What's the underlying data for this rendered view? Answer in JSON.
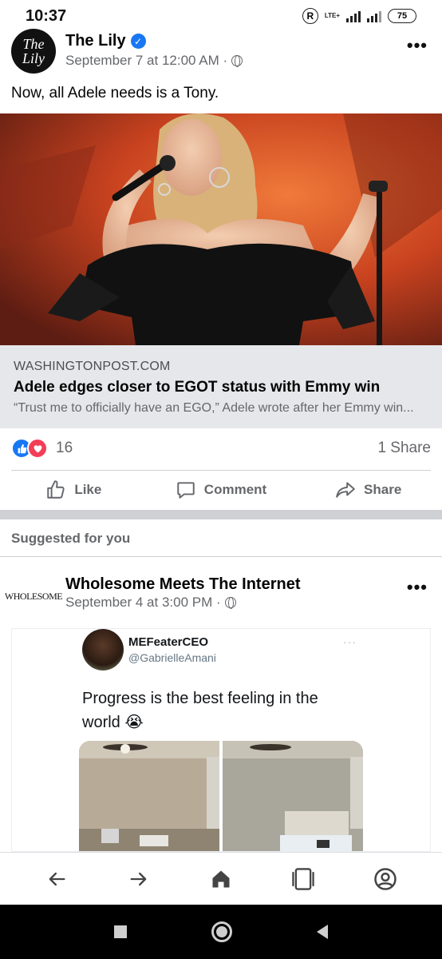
{
  "status_bar": {
    "time": "10:37",
    "r_badge": "R",
    "network": "LTE+",
    "battery": "75"
  },
  "post": {
    "page_name": "The Lily",
    "avatar_text_top": "The",
    "avatar_text_bottom": "Lily",
    "meta": "September 7 at 12:00 AM ·",
    "text": "Now, all Adele needs is a Tony.",
    "link": {
      "domain": "WASHINGTONPOST.COM",
      "title": "Adele edges closer to EGOT status with Emmy win",
      "description": "“Trust me to officially have an EGO,” Adele wrote after her Emmy win..."
    },
    "reaction_count": "16",
    "share_count": "1 Share",
    "actions": {
      "like": "Like",
      "comment": "Comment",
      "share": "Share"
    }
  },
  "suggested": {
    "label": "Suggested for you",
    "page_name": "Wholesome Meets The Internet",
    "avatar_text": "WHOLESOME",
    "meta": "September 4 at 3:00 PM ·",
    "tweet": {
      "name": "MEFeaterCEO",
      "handle": "@GabrielleAmani",
      "more": "···",
      "text": "Progress is the best feeling in the world 😭"
    }
  },
  "colors": {
    "facebook_blue": "#1877f2",
    "love_red": "#f33e58",
    "secondary_text": "#65676b",
    "link_box_bg": "#e6e7ea"
  }
}
